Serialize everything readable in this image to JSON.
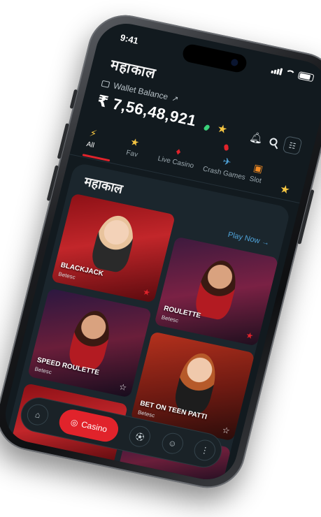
{
  "status_bar": {
    "time": "9:41"
  },
  "brand": {
    "logo_text": "महाकाल"
  },
  "wallet": {
    "label": "Wallet Balance",
    "balance": "₹ 7,56,48,921"
  },
  "header_icons": [
    "bell-icon",
    "search-icon",
    "menu-icon"
  ],
  "tabs": [
    {
      "label": "All",
      "icon": "⚡",
      "active": true
    },
    {
      "label": "Fav",
      "icon": "★"
    },
    {
      "label": "Live Casino",
      "icon": "♦"
    },
    {
      "label": "Crash Games",
      "icon": "✈"
    },
    {
      "label": "Slot",
      "icon": "▣"
    }
  ],
  "section": {
    "logo_text": "महाकाल",
    "play_now": "Play Now →"
  },
  "games": [
    {
      "name": "BLACKJACK",
      "provider": "Betesc"
    },
    {
      "name": "ROULETTE",
      "provider": "Betesc"
    },
    {
      "name": "SPEED ROULETTE",
      "provider": "Betesc"
    },
    {
      "name": "BET ON TEEN PATTI",
      "provider": "Betesc"
    }
  ],
  "bottom_nav": {
    "casino_label": "Casino"
  },
  "colors": {
    "accent_red": "#e1232b",
    "link_blue": "#4fa3d9",
    "background": "#121a1f"
  }
}
